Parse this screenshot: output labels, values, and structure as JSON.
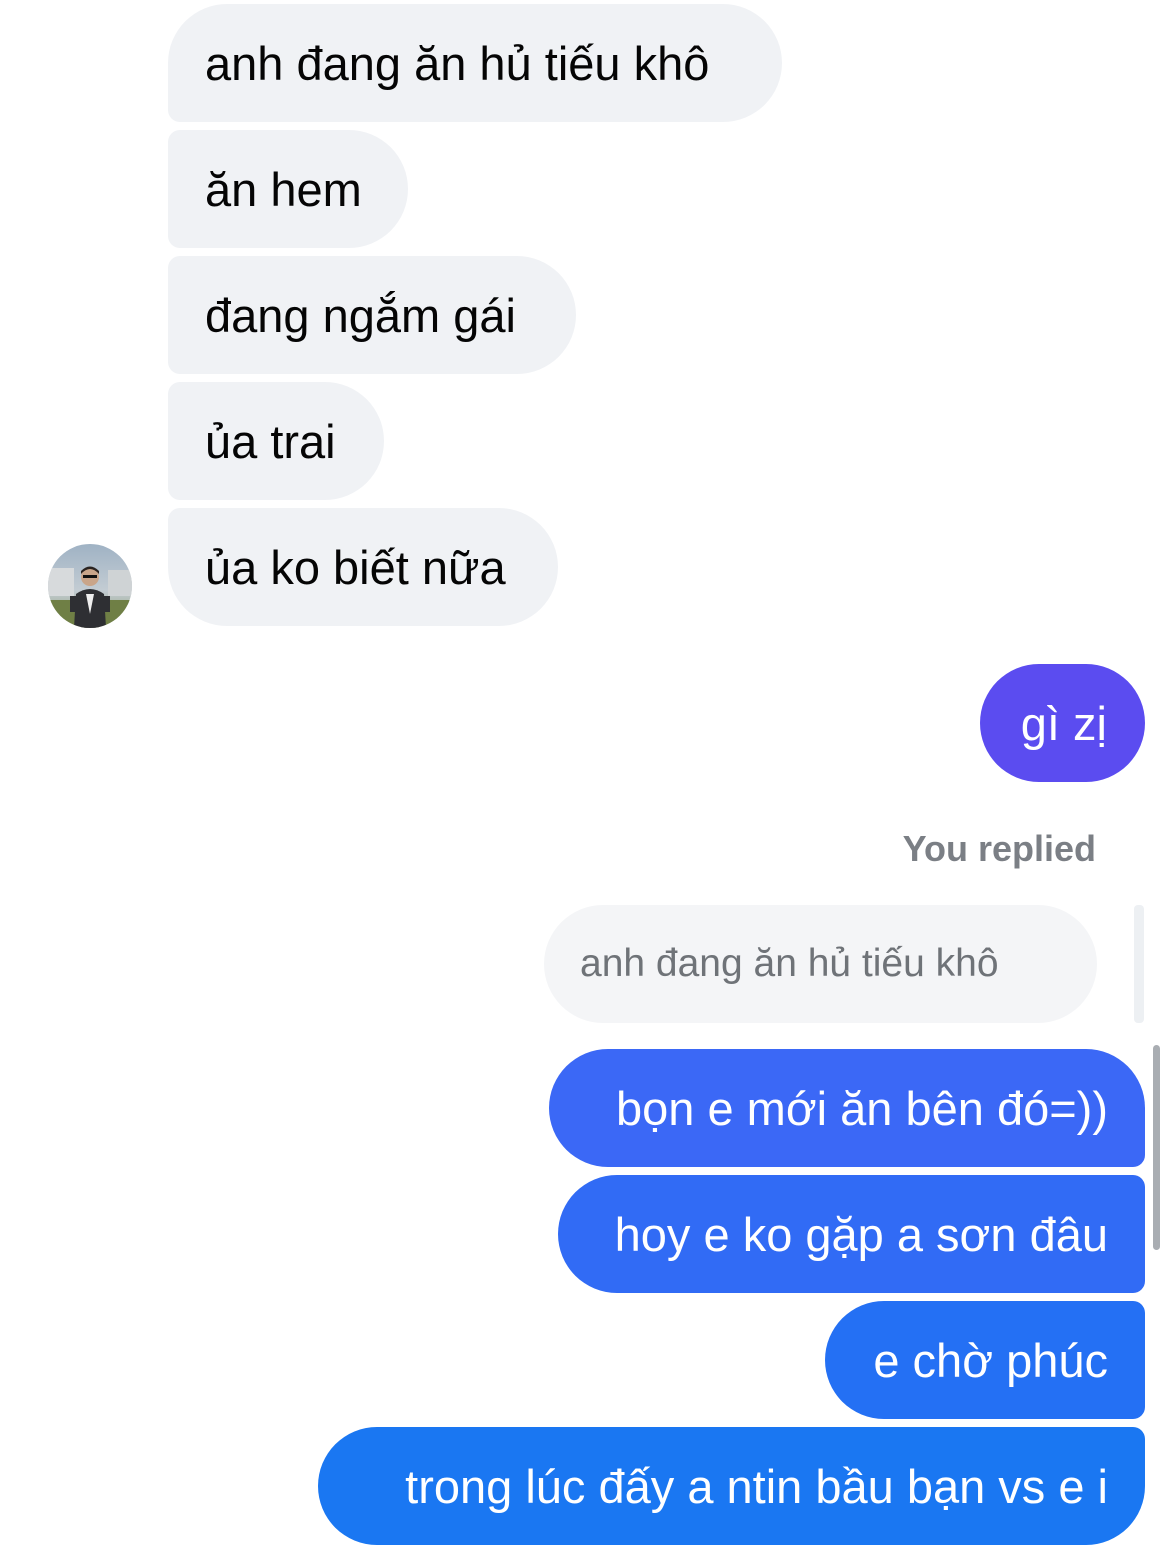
{
  "colors": {
    "incoming_bubble": "#f0f2f5",
    "outgoing_purple": "#5b4cf0",
    "outgoing_blue_top": "#3b68f6",
    "outgoing_blue_bottom": "#1a77f2",
    "muted_text": "#7b7f85"
  },
  "incoming": [
    {
      "text": "anh đang ăn hủ tiếu khô"
    },
    {
      "text": "ăn hem"
    },
    {
      "text": "đang ngắm gái"
    },
    {
      "text": "ủa trai"
    },
    {
      "text": "ủa ko biết nữa"
    }
  ],
  "avatar": {
    "icon": "user-avatar-photo"
  },
  "outgoing_first": {
    "text": "gì zị"
  },
  "reply": {
    "label": "You replied",
    "quoted_text": "anh đang ăn hủ tiếu khô"
  },
  "outgoing": [
    {
      "text": "bọn e mới ăn bên đó=))"
    },
    {
      "text": "hoy e ko gặp a sơn đâu"
    },
    {
      "text": "e chờ phúc"
    },
    {
      "text": "trong lúc đấy a ntin bầu bạn vs e i"
    }
  ]
}
